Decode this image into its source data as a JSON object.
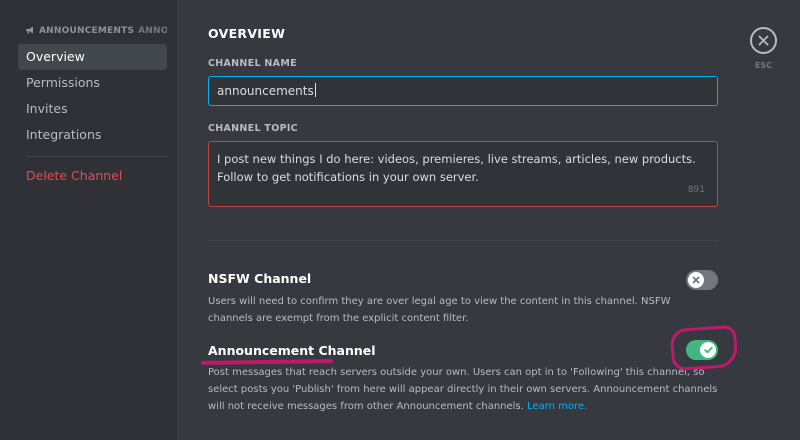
{
  "sidebar": {
    "header": "ANNOUNCEMENTS",
    "header_suffix": "ANNO...",
    "items": [
      {
        "label": "Overview"
      },
      {
        "label": "Permissions"
      },
      {
        "label": "Invites"
      },
      {
        "label": "Integrations"
      }
    ],
    "delete_label": "Delete Channel"
  },
  "main": {
    "title": "OVERVIEW",
    "channel_name": {
      "label": "CHANNEL NAME",
      "value": "announcements"
    },
    "channel_topic": {
      "label": "CHANNEL TOPIC",
      "value": "I post new things I do here: videos, premieres, live streams, articles, new products. Follow to get notifications in your own server.",
      "remaining": "891"
    },
    "nsfw": {
      "title": "NSFW Channel",
      "description": "Users will need to confirm they are over legal age to view the content in this channel. NSFW channels are exempt from the explicit content filter.",
      "enabled": false
    },
    "announcement": {
      "title": "Announcement Channel",
      "description": "Post messages that reach servers outside your own. Users can opt in to 'Following' this channel, so select posts you 'Publish' from here will appear directly in their own servers. Announcement channels will not receive messages from other Announcement channels.",
      "link": "Learn more.",
      "enabled": true
    }
  },
  "close": {
    "label": "ESC",
    "icon": "close-icon"
  },
  "colors": {
    "background": "#36393f",
    "sidebar": "#2f3136",
    "accent_blue": "#00b0f4",
    "toggle_on": "#43b581",
    "danger": "#f04747",
    "annotation": "#c0196a"
  }
}
